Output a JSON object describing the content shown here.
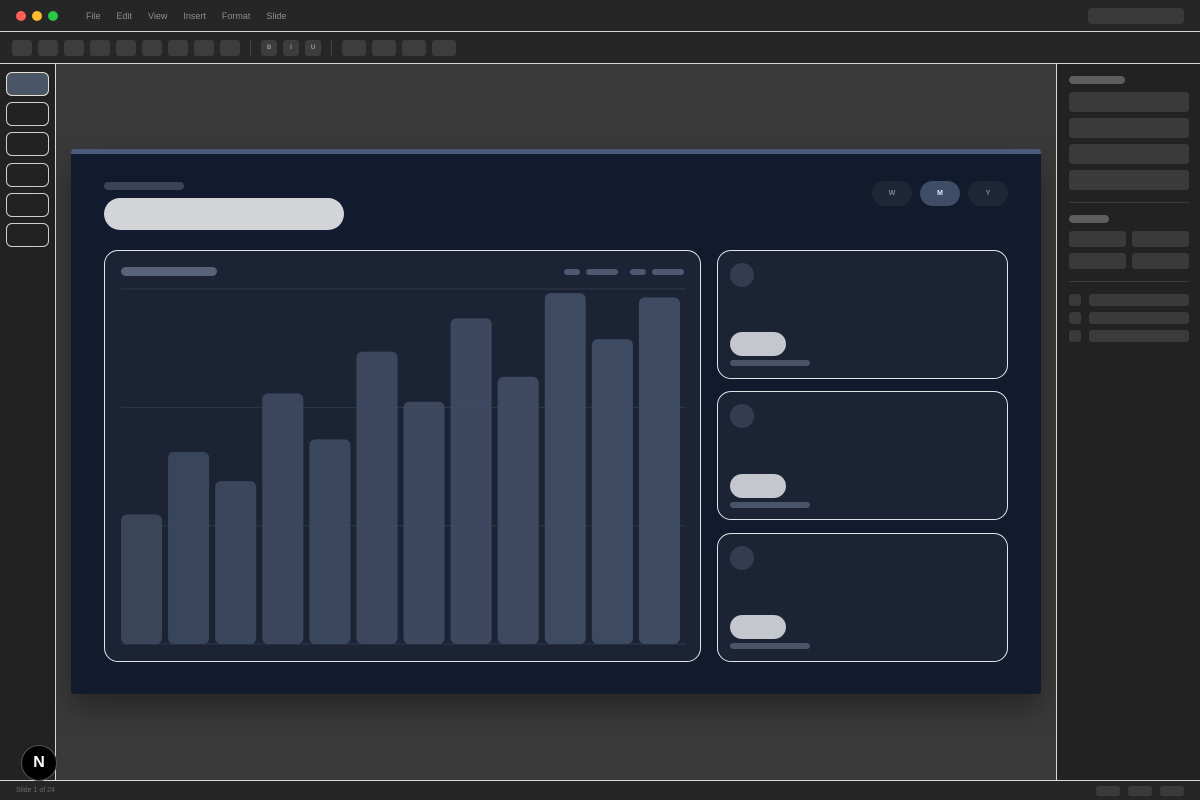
{
  "menu": {
    "items": [
      "File",
      "Edit",
      "View",
      "Insert",
      "Format",
      "Slide"
    ]
  },
  "toolbar": {
    "format_buttons": [
      "B",
      "I",
      "U"
    ]
  },
  "slide": {
    "period_tabs": [
      "W",
      "M",
      "Y"
    ],
    "selected_period": "M"
  },
  "chart_data": {
    "type": "bar",
    "values": [
      31,
      46,
      39,
      60,
      49,
      70,
      58,
      78,
      64,
      84,
      73,
      83
    ],
    "ylim": [
      0,
      85
    ],
    "gridlines": true
  },
  "status": {
    "slide_position": "Slide 1 of 24"
  },
  "fab": {
    "glyph": "N"
  },
  "colors": {
    "slide_background": "#121a2d",
    "bar": "#3f4b62",
    "active_tab": "#3f4d66",
    "selected_thumbnail": "#4a5568"
  }
}
